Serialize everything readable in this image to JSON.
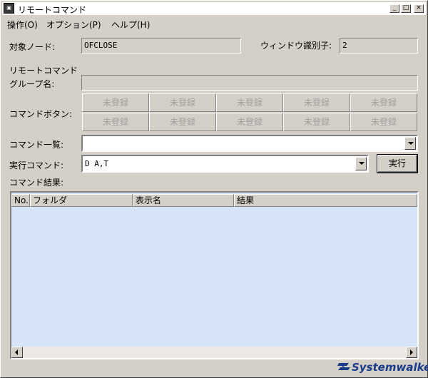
{
  "window": {
    "title": "リモートコマンド"
  },
  "titlebar": {
    "minimize": "_",
    "maximize": "□",
    "close": "×"
  },
  "menu": [
    {
      "label": "操作(O)"
    },
    {
      "label": "オプション(P)"
    },
    {
      "label": "ヘルプ(H)"
    }
  ],
  "target_node": {
    "label": "対象ノード:",
    "value": "OFCLOSE"
  },
  "window_id": {
    "label": "ウィンドウ識別子:",
    "value": "2"
  },
  "remote_group": {
    "label_line1": "リモートコマンド",
    "label_line2": "グループ名:",
    "value": ""
  },
  "command_buttons": {
    "label": "コマンドボタン:",
    "buttons": [
      "未登録",
      "未登録",
      "未登録",
      "未登録",
      "未登録",
      "未登録",
      "未登録",
      "未登録",
      "未登録",
      "未登録"
    ]
  },
  "command_list": {
    "label": "コマンド一覧:",
    "value": ""
  },
  "exec_command": {
    "label": "実行コマンド:",
    "value": "D A,T",
    "button": "実行"
  },
  "results": {
    "label": "コマンド結果:",
    "columns": [
      "No.",
      "フォルダ",
      "表示名",
      "結果"
    ],
    "rows": []
  },
  "brand": {
    "logo_text": "Systemwalker",
    "color": "#1a3a8a"
  },
  "colors": {
    "list_bg": "#d6e4fa",
    "face": "#d4d0c8"
  }
}
